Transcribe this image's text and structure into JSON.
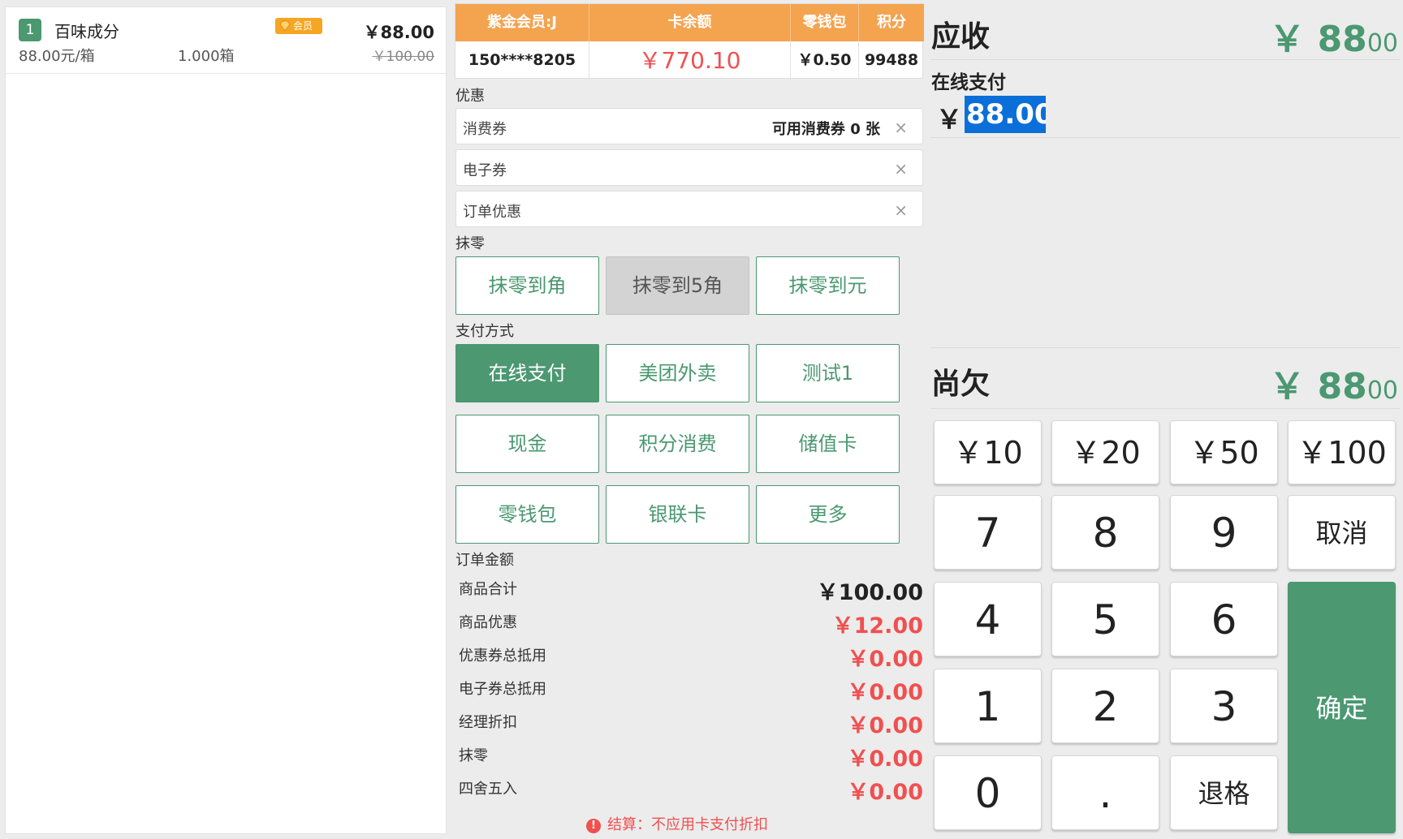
{
  "cart": {
    "items": [
      {
        "index": "1",
        "name": "百味成分",
        "badge": "会员",
        "price": "￥88.00",
        "unit_price": "88.00元/箱",
        "quantity": "1.000箱",
        "original_price": "￥100.00"
      }
    ]
  },
  "member": {
    "headers": [
      "紫金会员:J",
      "卡余额",
      "零钱包",
      "积分"
    ],
    "phone": "150****8205",
    "balance": "￥770.10",
    "wallet": "￥0.50",
    "points": "99488"
  },
  "discount": {
    "section_label": "优惠",
    "coupons": {
      "label": "消费券",
      "info": "可用消费券 0 张"
    },
    "ecoupon": {
      "label": "电子券"
    },
    "order_discount": {
      "label": "订单优惠"
    },
    "clear_symbol": "×"
  },
  "rounding": {
    "section_label": "抹零",
    "buttons": [
      "抹零到角",
      "抹零到5角",
      "抹零到元"
    ]
  },
  "payment_methods": {
    "section_label": "支付方式",
    "buttons": [
      "在线支付",
      "美团外卖",
      "测试1",
      "现金",
      "积分消费",
      "储值卡",
      "零钱包",
      "银联卡",
      "更多"
    ]
  },
  "order_amount": {
    "section_label": "订单金额",
    "rows": [
      {
        "label": "商品合计",
        "value": "￥100.00"
      },
      {
        "label": "商品优惠",
        "value": "￥12.00"
      },
      {
        "label": "优惠券总抵用",
        "value": "￥0.00"
      },
      {
        "label": "电子券总抵用",
        "value": "￥0.00"
      },
      {
        "label": "经理折扣",
        "value": "￥0.00"
      },
      {
        "label": "抹零",
        "value": "￥0.00"
      },
      {
        "label": "四舍五入",
        "value": "￥0.00"
      }
    ],
    "note_icon": "!",
    "note": "结算：不应用卡支付折扣"
  },
  "checkout": {
    "receivable_label": "应收",
    "receivable_main": "￥ 88",
    "receivable_cents": "00",
    "online_pay_label": "在线支付",
    "currency": "￥",
    "pay_amount": "88.00",
    "owed_label": "尚欠",
    "owed_main": "￥ 88",
    "owed_cents": "00"
  },
  "keypad": {
    "quick": [
      "￥10",
      "￥20",
      "￥50",
      "￥100"
    ],
    "keys": [
      "7",
      "8",
      "9",
      "4",
      "5",
      "6",
      "1",
      "2",
      "3",
      "0",
      "."
    ],
    "cancel": "取消",
    "confirm": "确定",
    "backspace": "退格"
  },
  "colors": {
    "accent_green": "#4b9871",
    "header_orange": "#f4a34f",
    "alert_red": "#f05050"
  }
}
